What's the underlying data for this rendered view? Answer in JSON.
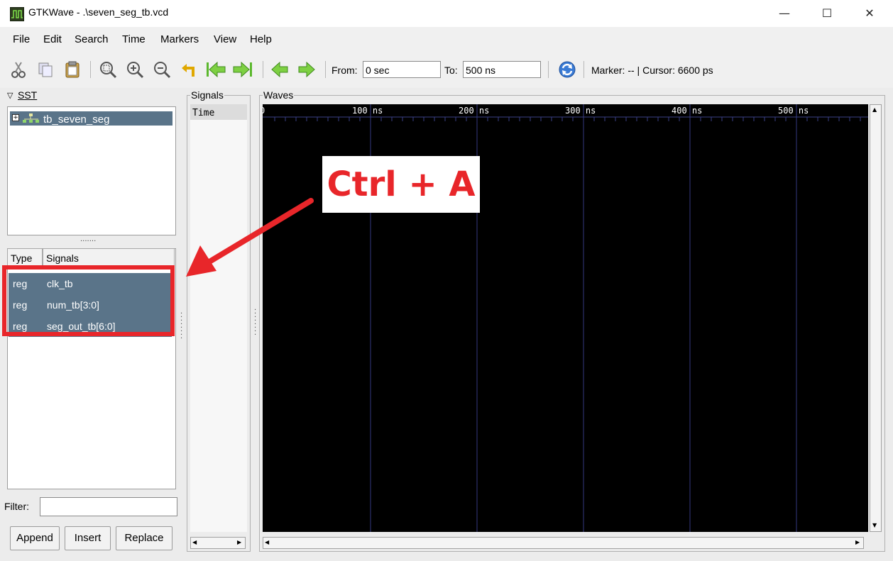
{
  "window": {
    "title": "GTKWave - .\\seven_seg_tb.vcd",
    "minimize": "—",
    "maximize": "☐",
    "close": "✕"
  },
  "menu": [
    "File",
    "Edit",
    "Search",
    "Time",
    "Markers",
    "View",
    "Help"
  ],
  "toolbar": {
    "from_label": "From:",
    "from_value": "0 sec",
    "to_label": "To:",
    "to_value": "500 ns",
    "status": "Marker: --  |  Cursor: 6600 ps"
  },
  "sst": {
    "header": "SST",
    "tree_item": "tb_seven_seg",
    "columns": [
      "Type",
      "Signals"
    ],
    "rows": [
      {
        "type": "reg",
        "name": "clk_tb"
      },
      {
        "type": "reg",
        "name": "num_tb[3:0]"
      },
      {
        "type": "reg",
        "name": "seg_out_tb[6:0]"
      }
    ],
    "filter_label": "Filter:",
    "filter_value": "",
    "buttons": [
      "Append",
      "Insert",
      "Replace"
    ]
  },
  "signals_panel": {
    "header": "Signals",
    "time_label": "Time"
  },
  "waves_panel": {
    "header": "Waves",
    "ticks": [
      "0",
      "100 ns",
      "200 ns",
      "300 ns",
      "400 ns",
      "500 ns"
    ]
  },
  "annotation": {
    "text": "Ctrl + A",
    "color": "#e8262a"
  }
}
